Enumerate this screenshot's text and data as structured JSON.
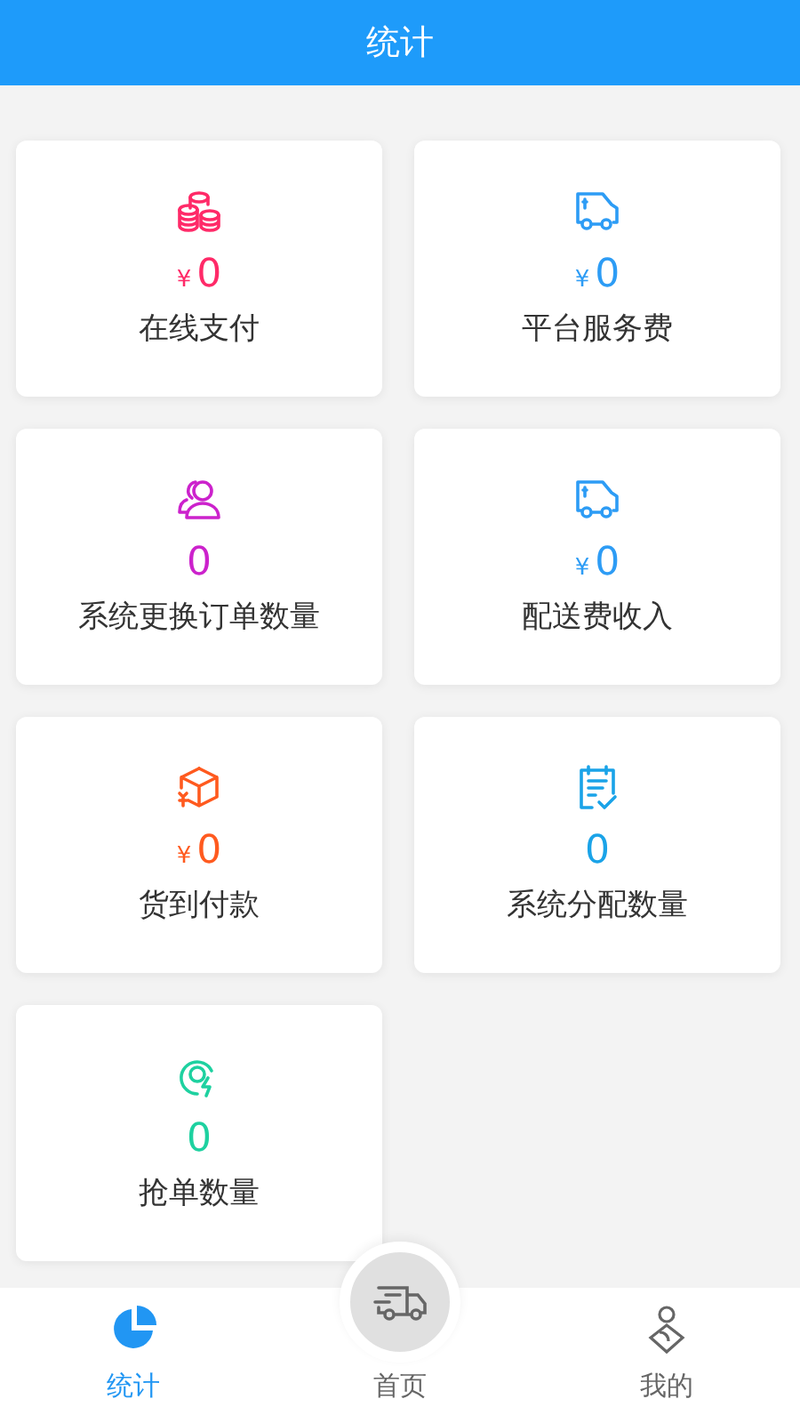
{
  "header": {
    "title": "统计"
  },
  "stats": [
    {
      "kind": "coins",
      "color": "#ff2a68",
      "currency": "¥",
      "value": "0",
      "label": "在线支付"
    },
    {
      "kind": "van",
      "color": "#2d9cf5",
      "currency": "¥",
      "value": "0",
      "label": "平台服务费"
    },
    {
      "kind": "people",
      "color": "#cc22cc",
      "value": "0",
      "label": "系统更换订单数量"
    },
    {
      "kind": "van",
      "color": "#2d9cf5",
      "currency": "¥",
      "value": "0",
      "label": "配送费收入"
    },
    {
      "kind": "box",
      "color": "#ff5a1f",
      "currency": "¥",
      "value": "0",
      "label": "货到付款"
    },
    {
      "kind": "clipboard",
      "color": "#1aa3e8",
      "value": "0",
      "label": "系统分配数量"
    },
    {
      "kind": "target",
      "color": "#1ed1a0",
      "value": "0",
      "label": "抢单数量"
    }
  ],
  "nav": [
    {
      "label": "统计",
      "selected": true,
      "raised": false
    },
    {
      "label": "首页",
      "selected": false,
      "raised": true
    },
    {
      "label": "我的",
      "selected": false,
      "raised": false
    }
  ]
}
